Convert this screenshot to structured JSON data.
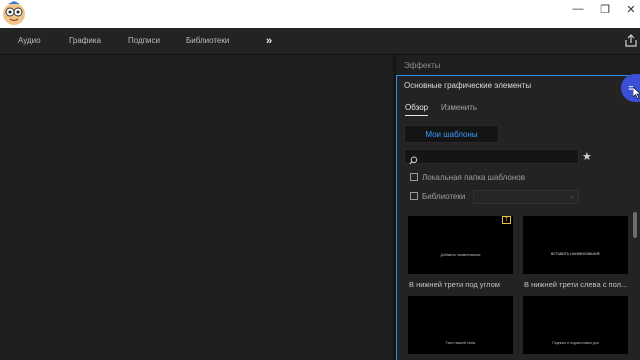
{
  "menu": {
    "items": [
      "Аудио",
      "Графика",
      "Подписи",
      "Библиотеки"
    ],
    "more_icon": "chevron-double-right-icon",
    "export_icon": "export-icon"
  },
  "window": {
    "min": "—",
    "max": "❐",
    "close": "✕"
  },
  "panel": {
    "effects_tab": "Эффекты",
    "title": "Основные графические элементы",
    "menu_icon": "≡",
    "tabs": [
      "Обзор",
      "Изменить"
    ],
    "my_templates": "Мои шаблоны",
    "star": "★",
    "local_folder": "Локальная папка шаблонов",
    "libraries": "Библиотеки",
    "templates": [
      {
        "thumb_text": "Добавить наименование",
        "label": "В нижней трети под углом"
      },
      {
        "thumb_text": "ВСТАВИТЬ НАИМЕНОВАНИЕ",
        "label": "В нижней трети слева с пол..."
      },
      {
        "thumb_text": "Текст вашей темы",
        "label": ""
      },
      {
        "thumb_text": "Подписи и подзаголовок для",
        "label": ""
      }
    ]
  },
  "colors": {
    "accent": "#2d8ceb",
    "link": "#3d9bff",
    "badge": "#e6c33a",
    "menu_button": "#3a4fd6"
  }
}
